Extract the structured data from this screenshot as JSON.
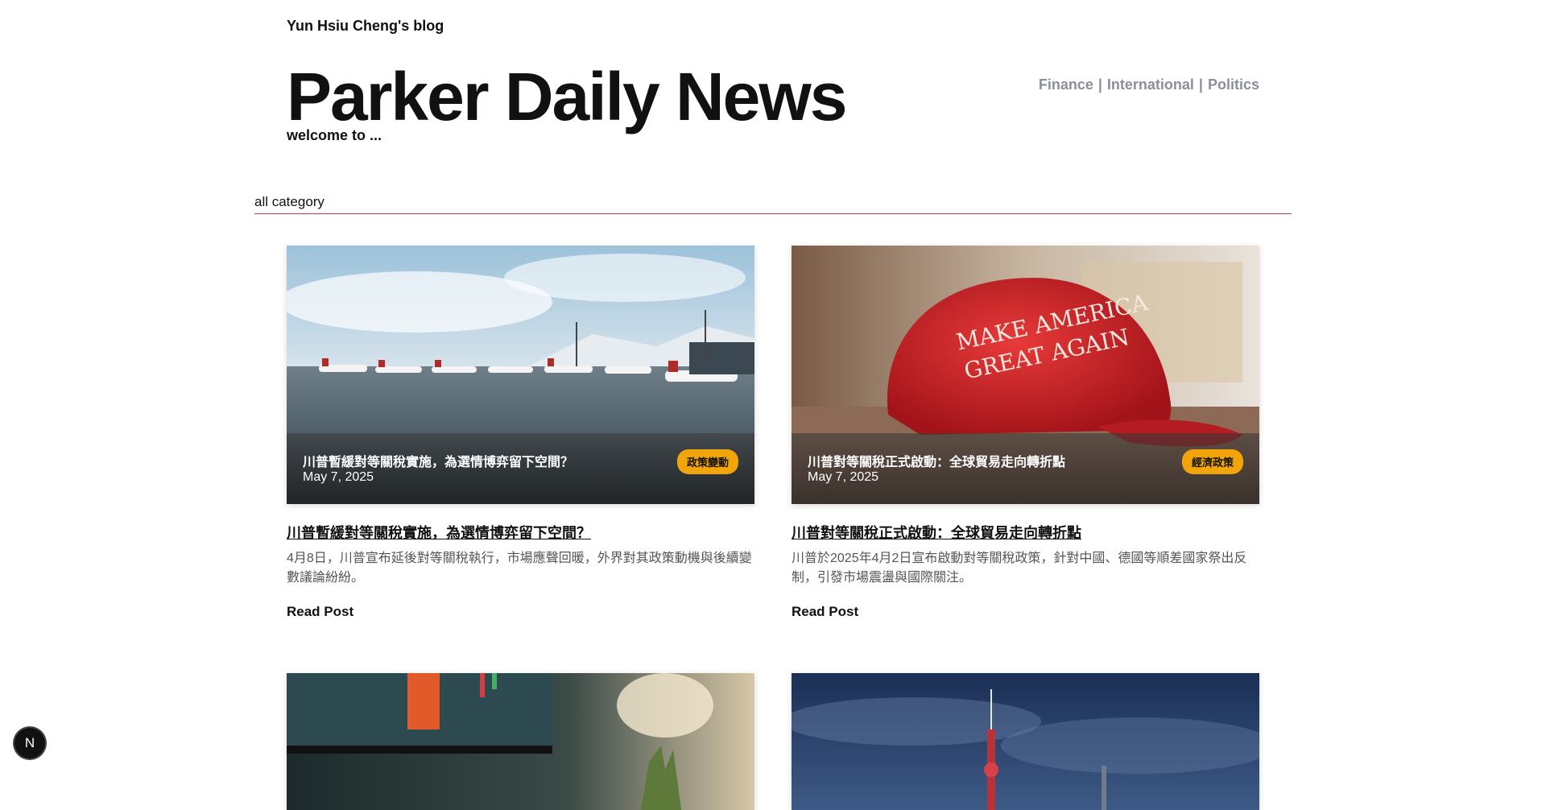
{
  "header": {
    "blog_name": "Yun Hsiu Cheng's blog",
    "title": "Parker Daily News",
    "tagline": "welcome to ...",
    "nav": [
      {
        "label": "Finance"
      },
      {
        "label": "International"
      },
      {
        "label": "Politics"
      }
    ],
    "nav_separator": "|"
  },
  "category_filter": {
    "label": "all category"
  },
  "posts": [
    {
      "image": "airport-tarmac-planes-snow",
      "overlay_title": "川普暫緩對等關稅實施，為選情博弈留下空間？",
      "date": "May 7, 2025",
      "tag": "政策變動",
      "title": "川普暫緩對等關稅實施，為選情博弈留下空間？",
      "excerpt": "4月8日，川普宣布延後對等關稅執行，市場應聲回暖，外界對其政策動機與後續變數議論紛紛。",
      "read_more": "Read Post"
    },
    {
      "image": "red-maga-cap",
      "cap_text_line1": "MAKE AMERICA",
      "cap_text_line2": "GREAT AGAIN",
      "overlay_title": "川普對等關稅正式啟動：全球貿易走向轉折點",
      "date": "May 7, 2025",
      "tag": "經濟政策",
      "title": "川普對等關稅正式啟動：全球貿易走向轉折點",
      "excerpt": "川普於2025年4月2日宣布啟動對等關稅政策，針對中國、德國等順差國家祭出反制，引發市場震盪與國際關注。",
      "read_more": "Read Post"
    },
    {
      "image": "laptop-stock-chart-plant"
    },
    {
      "image": "city-tower-night-sky"
    }
  ],
  "dev_badge": {
    "label": "N"
  },
  "colors": {
    "accent_tag": "#f2a50a",
    "divider": "#c9383a",
    "nav_text": "#8a8f98"
  }
}
